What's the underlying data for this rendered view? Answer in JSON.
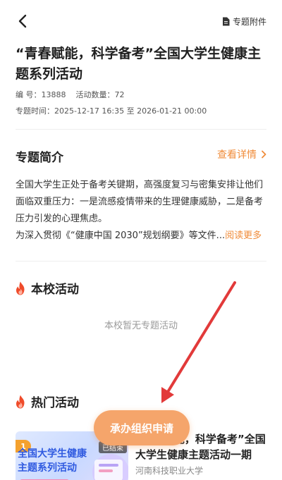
{
  "header": {
    "attachment_label": "专题附件",
    "title": "“青春赋能，科学备考”全国大学生健康主题系列活动",
    "number_label": "编  号：",
    "number_value": "13888",
    "count_label": "活动数量：",
    "count_value": "72",
    "time_label": "专题时间：",
    "time_start": "2025-12-17 16:35",
    "time_sep": "至",
    "time_end": "2026-01-21 00:00"
  },
  "intro": {
    "title": "专题简介",
    "detail_label": "查看详情",
    "text": "全国大学生正处于备考关键期，高强度复习与密集安排让他们面临双重压力：一是流感疫情带来的生理健康威胁，二是备考压力引发的心理焦虑。",
    "text2": "为深入贯彻《“健康中国 2030”规划纲要》等文件...",
    "read_more": "阅读更多"
  },
  "school": {
    "title": "本校活动",
    "empty_text": "本校暂无专题活动"
  },
  "hot": {
    "title": "热门活动",
    "card": {
      "rank": "1",
      "thumb_text": "全国大学生健康主题系列活动",
      "status": "已结束",
      "title": "“青春赋能，科学备考”全国大学生健康主题活动一期",
      "org": "河南科技职业大学"
    }
  },
  "float_button": {
    "label": "承办组织申请"
  },
  "colors": {
    "accent": "#f08c3a",
    "button": "#f5a56b",
    "fire": "#ef4b2a",
    "arrow": "#e23a3a"
  }
}
